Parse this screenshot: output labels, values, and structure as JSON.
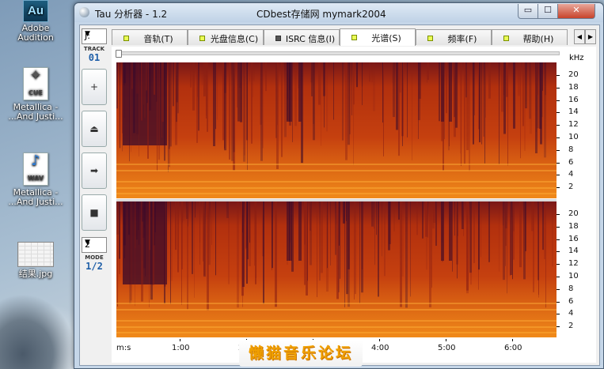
{
  "desktop": {
    "icons": [
      {
        "label_line1": "Adobe",
        "label_line2": "Audition",
        "tile": "Au",
        "icon": "adobe-audition-icon"
      },
      {
        "label_line1": "Metallica -",
        "label_line2": "...And Justi...",
        "tile": "CUE",
        "icon": "cue-file-icon"
      },
      {
        "label_line1": "Metallica -",
        "label_line2": "...And Justi...",
        "tile": "WAV",
        "icon": "wav-file-icon"
      },
      {
        "label_line1": "结果.jpg",
        "label_line2": "",
        "tile": "",
        "icon": "jpg-file-icon"
      }
    ]
  },
  "window": {
    "title": "Tau 分析器 - 1.2",
    "title_right": "CDbest存储网 mymark2004",
    "buttons": {
      "minimize": "▭",
      "maximize": "☐",
      "close": "✕"
    }
  },
  "left_panel": {
    "drive_value": "J:",
    "track_label": "TRACK",
    "track_value": "01",
    "buttons": [
      {
        "name": "add",
        "glyph": "+"
      },
      {
        "name": "eject",
        "glyph": "⏏"
      },
      {
        "name": "next",
        "glyph": "➡"
      },
      {
        "name": "stop",
        "glyph": "■"
      }
    ],
    "mode_value": "2",
    "mode_label": "MODE",
    "mode_display": "1/2"
  },
  "tabs": [
    {
      "label": "音轨(T)",
      "led": "green"
    },
    {
      "label": "光盘信息(C)",
      "led": "green"
    },
    {
      "label": "ISRC 信息(I)",
      "led": "square"
    },
    {
      "label": "光谱(S)",
      "led": "green",
      "active": true
    },
    {
      "label": "频率(F)",
      "led": "green"
    },
    {
      "label": "帮助(H)",
      "led": "green"
    }
  ],
  "spectrum": {
    "y_unit": "kHz",
    "y_ticks": [
      "20",
      "18",
      "16",
      "14",
      "12",
      "10",
      "8",
      "6",
      "4",
      "2"
    ],
    "x_ticks": [
      "m:s",
      "1:00",
      "2:00",
      "3:00",
      "4:00",
      "5:00",
      "6:00"
    ],
    "colors": {
      "dark": "#3a0a2a",
      "mid": "#c5400f",
      "bright": "#f08a1a"
    }
  },
  "watermark": "懒猫音乐论坛"
}
